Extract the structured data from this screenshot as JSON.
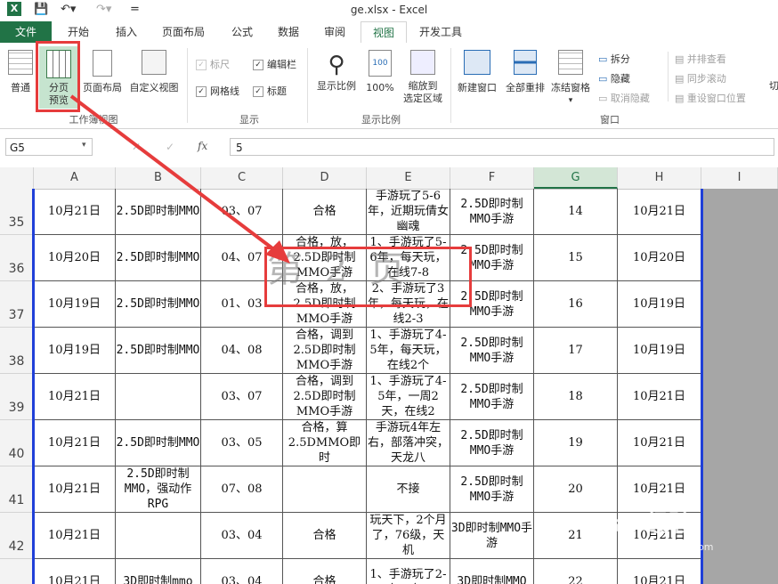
{
  "titlebar": {
    "undo_icon": "undo-icon",
    "redo_icon": "redo-icon",
    "save_icon": "save-icon",
    "title": "ge.xlsx - Excel"
  },
  "tabs": [
    "文件",
    "开始",
    "插入",
    "页面布局",
    "公式",
    "数据",
    "审阅",
    "视图",
    "开发工具"
  ],
  "ribbon": {
    "views": {
      "normal": "普通",
      "page_break_line1": "分页",
      "page_break_line2": "预览",
      "page_layout": "页面布局",
      "custom_view": "自定义视图",
      "group": "工作簿视图"
    },
    "show": {
      "ruler": "标尺",
      "formula_bar": "编辑栏",
      "gridlines": "网格线",
      "headings": "标题",
      "group": "显示"
    },
    "zoom": {
      "zoom": "显示比例",
      "zoom100": "100%",
      "zoom_sel_line1": "缩放到",
      "zoom_sel_line2": "选定区域",
      "group": "显示比例"
    },
    "window": {
      "new_window": "新建窗口",
      "arrange_all": "全部重排",
      "freeze": "冻结窗格",
      "split": "拆分",
      "hide": "隐藏",
      "unhide": "取消隐藏",
      "side_by_side": "并排查看",
      "sync_scroll": "同步滚动",
      "reset_pos": "重设窗口位置",
      "switch": "切",
      "group": "窗口"
    }
  },
  "formula_bar": {
    "name_box": "G5",
    "cancel": "✕",
    "enter": "✓",
    "fx": "fx",
    "value": "5"
  },
  "columns": [
    "A",
    "B",
    "C",
    "D",
    "E",
    "F",
    "G",
    "H",
    "I"
  ],
  "rows": [
    {
      "num": "35",
      "cells": [
        "10月21日",
        "2.5D即时制MMO",
        "03、07",
        "合格",
        "手游玩了5-6年，近期玩倩女幽魂",
        "2.5D即时制MMO手游",
        "14",
        "10月21日"
      ]
    },
    {
      "num": "36",
      "cells": [
        "10月20日",
        "2.5D即时制MMO",
        "04、07",
        "合格，放，2.5D即时制MMO手游",
        "1、手游玩了5-6年，每天玩，在线7-8",
        "2.5D即时制MMO手游",
        "15",
        "10月20日"
      ]
    },
    {
      "num": "37",
      "cells": [
        "10月19日",
        "2.5D即时制MMO",
        "01、03",
        "合格，放，2.5D即时制MMO手游",
        "2、手游玩了3年，每天玩，在线2-3",
        "2.5D即时制MMO手游",
        "16",
        "10月19日"
      ]
    },
    {
      "num": "38",
      "cells": [
        "10月19日",
        "2.5D即时制MMO",
        "04、08",
        "合格，调到2.5D即时制MMO手游",
        "1、手游玩了4-5年，每天玩，在线2个",
        "2.5D即时制MMO手游",
        "17",
        "10月19日"
      ]
    },
    {
      "num": "39",
      "cells": [
        "10月21日",
        "",
        "03、07",
        "合格，调到2.5D即时制MMO手游",
        "1、手游玩了4-5年，一周2天，在线2",
        "2.5D即时制MMO手游",
        "18",
        "10月21日"
      ]
    },
    {
      "num": "40",
      "cells": [
        "10月21日",
        "2.5D即时制MMO",
        "03、05",
        "合格，算2.5DMMO即时",
        "手游玩4年左右，部落冲突，天龙八",
        "2.5D即时制MMO手游",
        "19",
        "10月21日"
      ]
    },
    {
      "num": "41",
      "cells": [
        "10月21日",
        "2.5D即时制MMO，强动作RPG",
        "07、08",
        "",
        "不接",
        "2.5D即时制MMO手游",
        "20",
        "10月21日"
      ]
    },
    {
      "num": "42",
      "cells": [
        "10月21日",
        "",
        "03、04",
        "合格",
        "玩天下，2个月了，76级，天机",
        "3D即时制MMO手游",
        "21",
        "10月21日"
      ]
    },
    {
      "num": "43",
      "cells": [
        "10月21日",
        "3D即时制mmo",
        "03、04",
        "合格",
        "1、手游玩了2-3年，每天",
        "3D即时制MMO",
        "22",
        "10月21日"
      ]
    }
  ],
  "watermark": "第 2 页",
  "baidu_logo": "Bai 经验",
  "baidu_url": "jingyan.baidu.com"
}
